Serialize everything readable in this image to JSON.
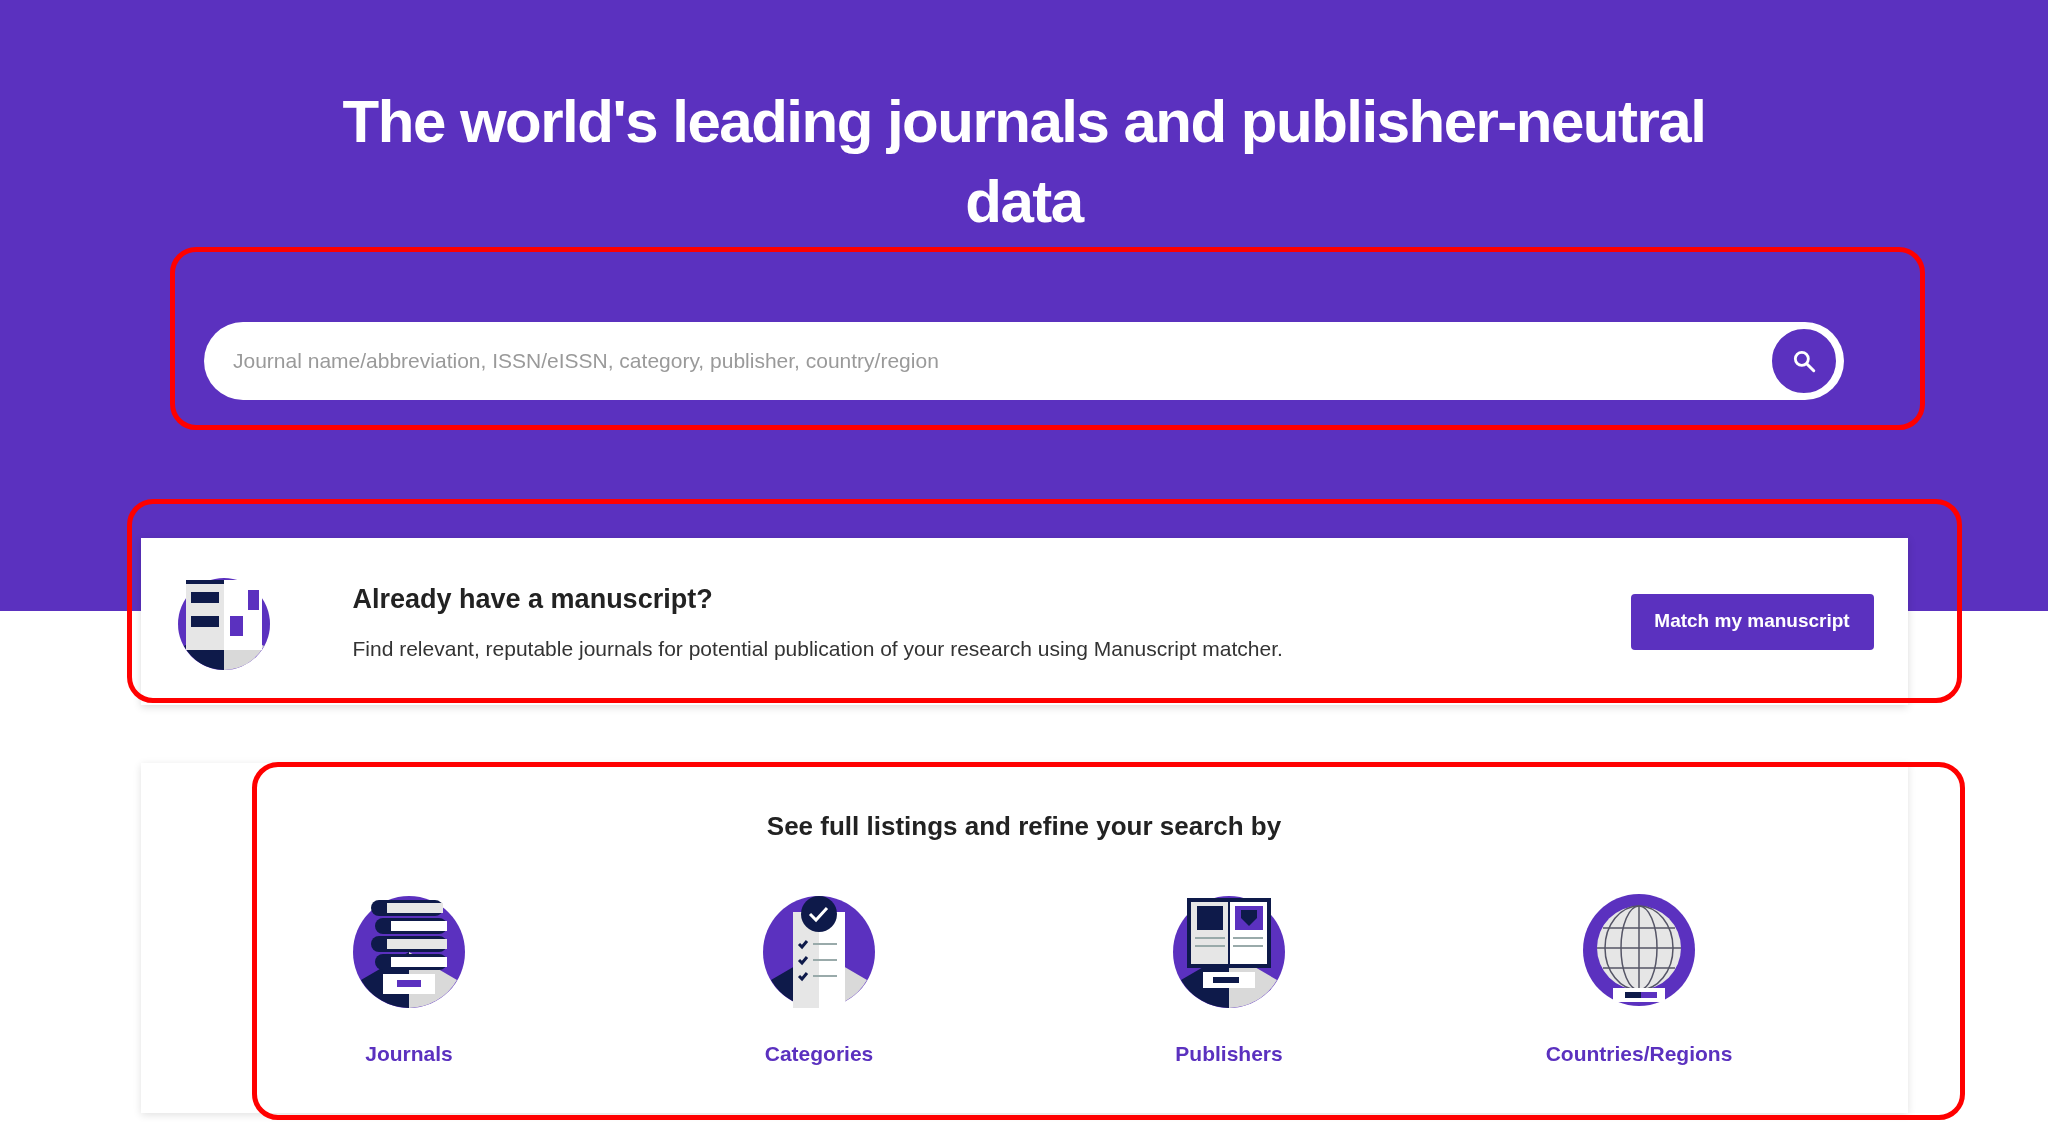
{
  "hero": {
    "title": "The world's leading journals and publisher-neutral data"
  },
  "search": {
    "placeholder": "Journal name/abbreviation, ISSN/eISSN, category, publisher, country/region"
  },
  "manuscript_card": {
    "title": "Already have a manuscript?",
    "description": "Find relevant, reputable journals for potential publication of your research using Manuscript matcher.",
    "button": "Match my manuscript"
  },
  "listings": {
    "heading": "See full listings and refine your search by",
    "items": [
      {
        "kind": "journals",
        "label": "Journals"
      },
      {
        "kind": "categories",
        "label": "Categories"
      },
      {
        "kind": "publishers",
        "label": "Publishers"
      },
      {
        "kind": "countries",
        "label": "Countries/Regions"
      }
    ]
  }
}
